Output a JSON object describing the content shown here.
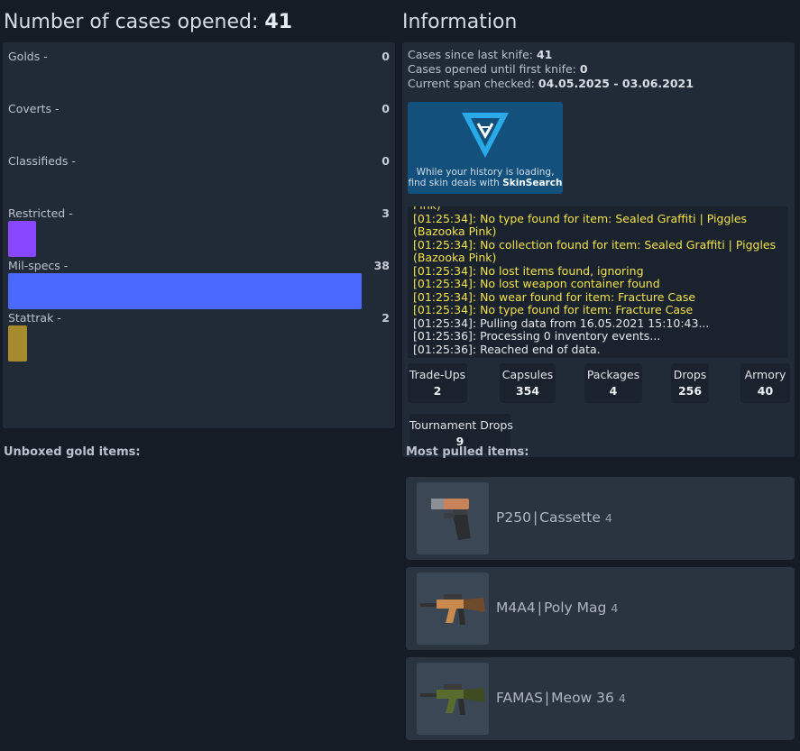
{
  "left": {
    "title_prefix": "Number of cases opened:",
    "title_count": "41",
    "stats": [
      {
        "label": "Golds -",
        "count": "0",
        "color": "#d4af37",
        "fill": 0
      },
      {
        "label": "Coverts -",
        "count": "0",
        "color": "#eb4b4b",
        "fill": 0
      },
      {
        "label": "Classifieds -",
        "count": "0",
        "color": "#d32ee6",
        "fill": 0
      },
      {
        "label": "Restricted -",
        "count": "3",
        "color": "#8847ff",
        "fill": 0.079
      },
      {
        "label": "Mil-specs -",
        "count": "38",
        "color": "#4b69ff",
        "fill": 1
      },
      {
        "label": "Stattrak -",
        "count": "2",
        "color": "#a68a2d",
        "fill": 0.053
      }
    ],
    "unboxed_gold_heading": "Unboxed gold items:"
  },
  "info": {
    "title": "Information",
    "cases_since_knife_label": "Cases since last knife:",
    "cases_since_knife_value": "41",
    "cases_until_knife_label": "Cases opened until first knife:",
    "cases_until_knife_value": "0",
    "span_label": "Current span checked:",
    "span_value": "04.05.2025 - 03.06.2021",
    "ad_text_prefix": "While your history is loading, find skin deals with",
    "ad_brand": "SkinSearch",
    "log": [
      {
        "text": "Pink)",
        "type": "warn"
      },
      {
        "text": "[01:25:34]: No type found for item: Sealed Graffiti | Piggles (Bazooka Pink)",
        "type": "warn"
      },
      {
        "text": "[01:25:34]: No collection found for item: Sealed Graffiti | Piggles (Bazooka Pink)",
        "type": "warn"
      },
      {
        "text": "[01:25:34]: No lost items found, ignoring",
        "type": "warn"
      },
      {
        "text": "[01:25:34]: No lost weapon container found",
        "type": "warn"
      },
      {
        "text": "[01:25:34]: No wear found for item: Fracture Case",
        "type": "warn"
      },
      {
        "text": "[01:25:34]: No type found for item: Fracture Case",
        "type": "warn"
      },
      {
        "text": "[01:25:34]: Pulling data from 16.05.2021 15:10:43...",
        "type": "info"
      },
      {
        "text": "[01:25:36]: Processing 0 inventory events...",
        "type": "info"
      },
      {
        "text": "[01:25:36]: Reached end of data.",
        "type": "info"
      }
    ],
    "counters": [
      {
        "label": "Trade-Ups",
        "value": "2"
      },
      {
        "label": "Capsules",
        "value": "354"
      },
      {
        "label": "Packages",
        "value": "4"
      },
      {
        "label": "Drops",
        "value": "256"
      },
      {
        "label": "Armory",
        "value": "40"
      },
      {
        "label": "Tournament Drops",
        "value": "9"
      }
    ]
  },
  "most_pulled": {
    "heading": "Most pulled items:",
    "items": [
      {
        "weapon": "P250",
        "skin": "Cassette",
        "count": "4",
        "icon": "pistol-icon"
      },
      {
        "weapon": "M4A4",
        "skin": "Poly Mag",
        "count": "4",
        "icon": "rifle-icon"
      },
      {
        "weapon": "FAMAS",
        "skin": "Meow 36",
        "count": "4",
        "icon": "rifle-icon"
      }
    ]
  }
}
